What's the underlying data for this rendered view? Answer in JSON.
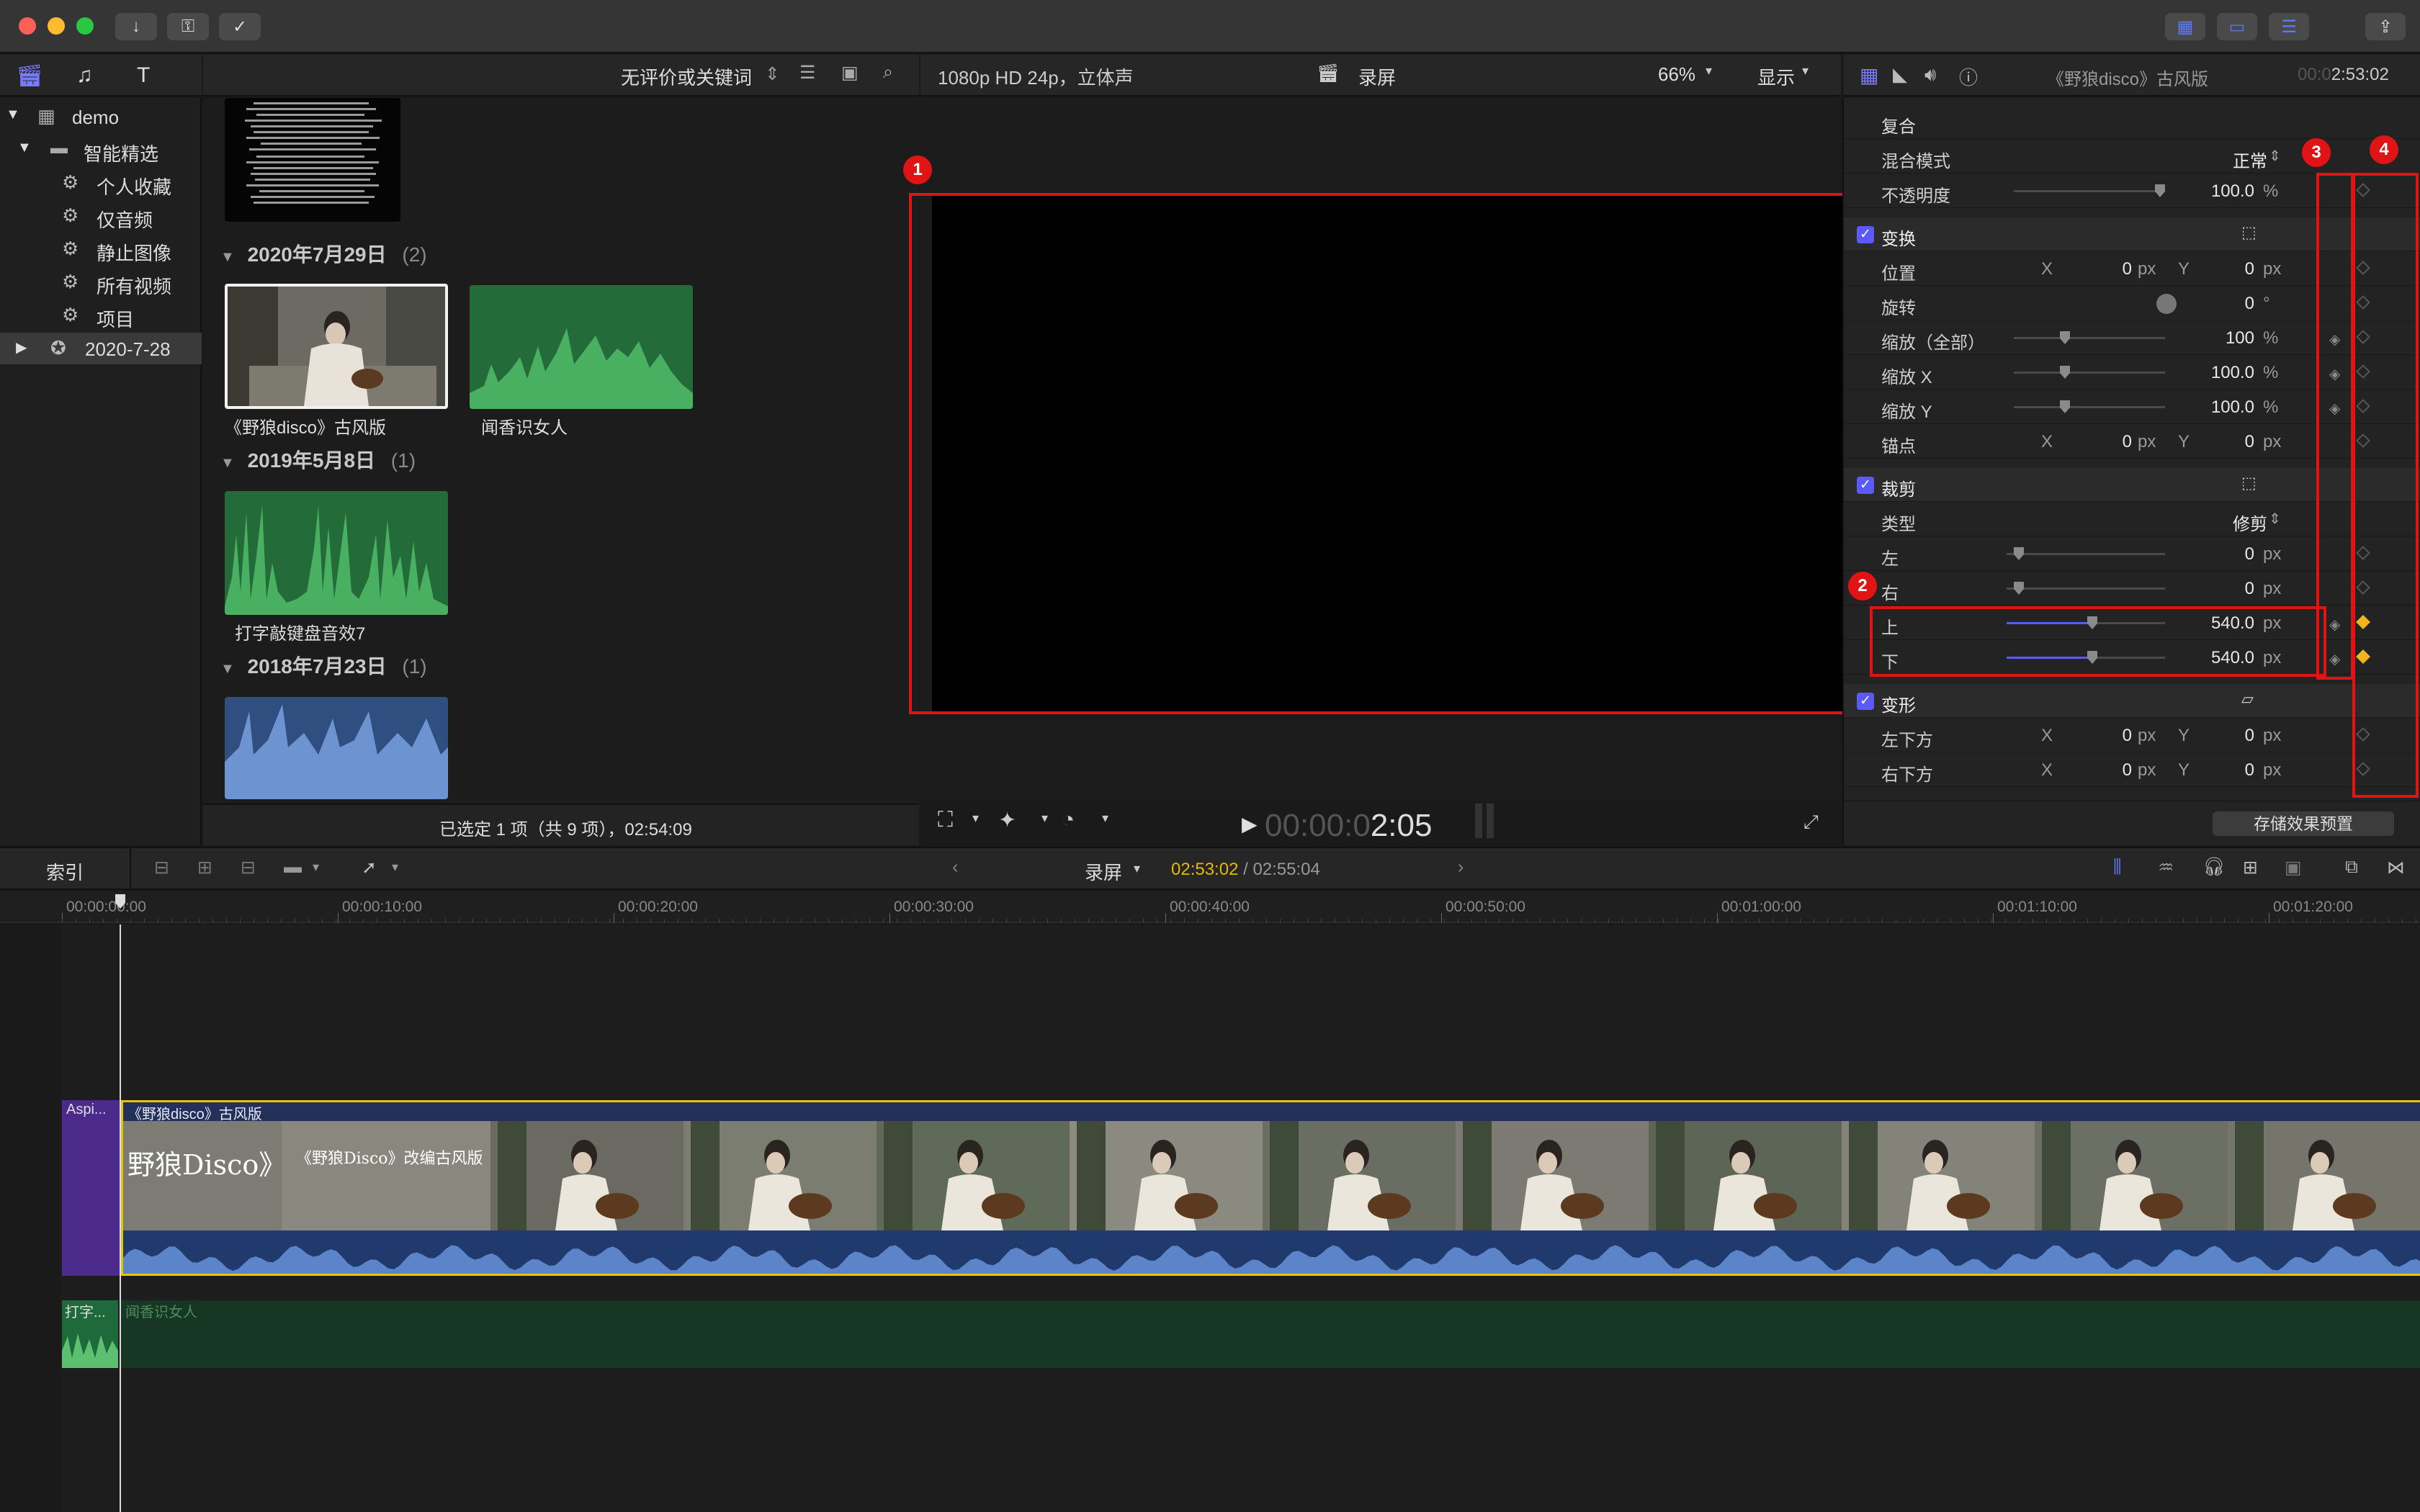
{
  "toolbar": {
    "buttons": [
      "import-icon",
      "keyword-icon",
      "check-icon"
    ],
    "right_buttons": [
      "grid-layout-icon",
      "film-layout-icon",
      "inspector-toggle-icon"
    ],
    "share_icon": "share-icon"
  },
  "library": {
    "header_icons": [
      "libraries-icon",
      "photos-icon",
      "titles-icon"
    ],
    "items": [
      {
        "label": "demo",
        "icon": "grid-icon"
      },
      {
        "label": "智能精选",
        "icon": "folder-icon"
      },
      {
        "label": "个人收藏",
        "icon": "gear-icon"
      },
      {
        "label": "仅音频",
        "icon": "gear-icon"
      },
      {
        "label": "静止图像",
        "icon": "gear-icon"
      },
      {
        "label": "所有视频",
        "icon": "gear-icon"
      },
      {
        "label": "项目",
        "icon": "gear-icon"
      },
      {
        "label": "2020-7-28",
        "icon": "star-icon"
      }
    ]
  },
  "browser": {
    "filter_label": "无评价或关键词",
    "groups": [
      {
        "date": "2020年7月29日",
        "count": "(2)",
        "clips": [
          "《野狼disco》古风版",
          "闻香识女人"
        ]
      },
      {
        "date": "2019年5月8日",
        "count": "(1)",
        "clips": [
          "打字敲键盘音效7"
        ]
      },
      {
        "date": "2018年7月23日",
        "count": "(1)",
        "clips": [
          ""
        ]
      }
    ],
    "status": "已选定 1 项（共 9 项），02:54:09"
  },
  "viewer": {
    "format": "1080p HD 24p，立体声",
    "project_name": "录屏",
    "zoom": "66%",
    "display_label": "显示",
    "timecode_dim": "00:00:0",
    "timecode_bright": "2:05"
  },
  "inspector": {
    "clip_title": "《野狼disco》古风版",
    "duration_dim": "00:0",
    "duration_bright": "2:53:02",
    "tab_icons": [
      "video-tab-icon",
      "color-tab-icon",
      "audio-tab-icon",
      "info-tab-icon"
    ],
    "composite": {
      "heading": "复合",
      "blend_label": "混合模式",
      "blend_value": "正常",
      "opacity_label": "不透明度",
      "opacity_value": "100.0",
      "opacity_unit": "%"
    },
    "transform": {
      "heading": "变换",
      "position_label": "位置",
      "x": "X",
      "y": "Y",
      "position_x": "0",
      "position_y": "0",
      "px": "px",
      "rotation_label": "旋转",
      "rotation_value": "0",
      "rotation_unit": "°",
      "scale_all_label": "缩放（全部）",
      "scale_all_value": "100",
      "percent": "%",
      "scale_x_label": "缩放 X",
      "scale_x_value": "100.0",
      "scale_y_label": "缩放 Y",
      "scale_y_value": "100.0",
      "anchor_label": "锚点",
      "anchor_x": "0",
      "anchor_y": "0"
    },
    "crop": {
      "heading": "裁剪",
      "type_label": "类型",
      "type_value": "修剪",
      "left_label": "左",
      "left_value": "0",
      "right_label": "右",
      "right_value": "0",
      "top_label": "上",
      "top_value": "540.0",
      "bottom_label": "下",
      "bottom_value": "540.0"
    },
    "distort": {
      "heading": "变形",
      "bottom_left_label": "左下方",
      "bl_x": "0",
      "bl_y": "0",
      "bottom_right_label": "右下方",
      "br_x": "0",
      "br_y": "0"
    },
    "save_preset": "存储效果预置"
  },
  "annotations": [
    "1",
    "2",
    "3",
    "4"
  ],
  "timeline_bar": {
    "index_label": "索引",
    "project_name": "录屏",
    "current_time": "02:53:02",
    "separator": " / ",
    "total_time": "02:55:04",
    "ruler": [
      "00:00:00:00",
      "00:00:10:00",
      "00:00:20:00",
      "00:00:30:00",
      "00:00:40:00",
      "00:00:50:00",
      "00:01:00:00",
      "00:01:10:00",
      "00:01:20:00"
    ]
  },
  "timeline": {
    "connected_label": "Aspi...",
    "main_clip_title": "《野狼disco》古风版",
    "title_card_text": "野狼Disco》",
    "title_card_sub": "《野狼Disco》改编古风版",
    "audio_clip_label": "打字...",
    "audio_track_title": "闻香识女人"
  },
  "colors": {
    "accent_blue": "#5a5aff",
    "keyframe": "#f3b51c",
    "annotation_red": "#e01414",
    "playhead_clip": "#e6c400",
    "audio_green": "#2f8a4a"
  }
}
